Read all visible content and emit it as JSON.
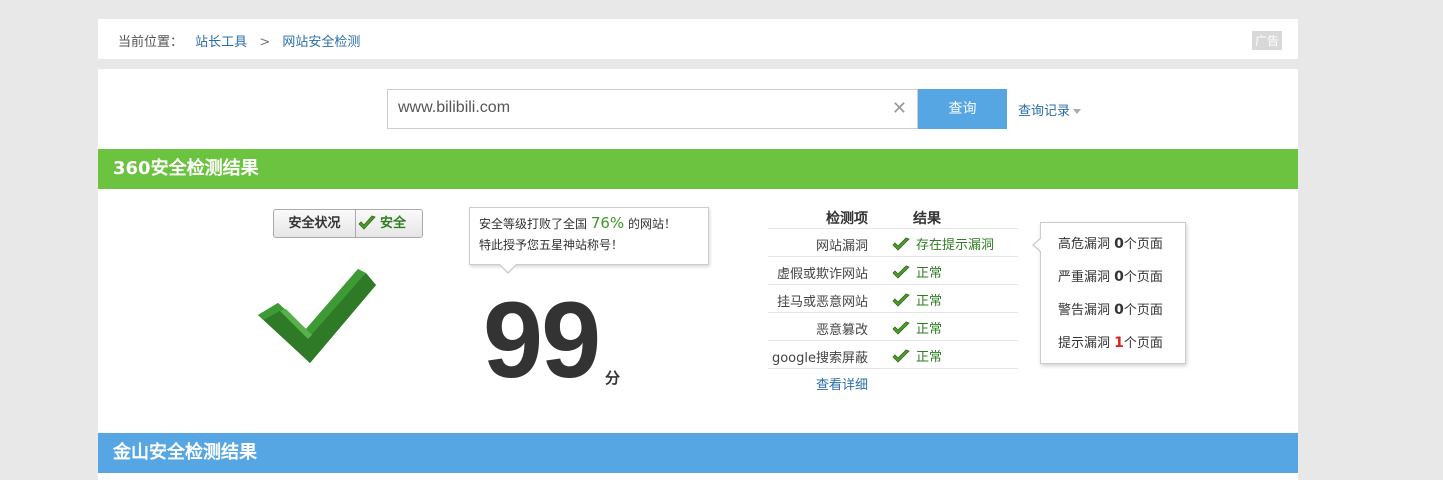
{
  "breadcrumb": {
    "label": "当前位置：",
    "items": [
      "站长工具",
      "网站安全检测"
    ],
    "separator": ">",
    "ad_label": "广告"
  },
  "search": {
    "value": "www.bilibili.com",
    "clear_icon": "close-icon",
    "button_label": "查询",
    "history_label": "查询记录"
  },
  "section_360": {
    "title": "360安全检测结果",
    "status_label": "安全状况",
    "status_value": "安全",
    "tooltip_prefix": "安全等级打败了全国 ",
    "tooltip_percent": "76%",
    "tooltip_suffix": " 的网站！",
    "tooltip_line2": "特此授予您五星神站称号！",
    "score": "99",
    "score_unit": "分",
    "table_header_item": "检测项",
    "table_header_result": "结果",
    "rows": [
      {
        "item": "网站漏洞",
        "result": "存在提示漏洞"
      },
      {
        "item": "虚假或欺诈网站",
        "result": "正常"
      },
      {
        "item": "挂马或恶意网站",
        "result": "正常"
      },
      {
        "item": "恶意篡改",
        "result": "正常"
      },
      {
        "item": "google搜索屏蔽",
        "result": "正常"
      }
    ],
    "detail_link": "查看详细",
    "vulns": [
      {
        "name": "高危漏洞",
        "count": "0",
        "unit": "个页面"
      },
      {
        "name": "严重漏洞",
        "count": "0",
        "unit": "个页面"
      },
      {
        "name": "警告漏洞",
        "count": "0",
        "unit": "个页面"
      },
      {
        "name": "提示漏洞",
        "count": "1",
        "unit": "个页面"
      }
    ]
  },
  "section_kingsoft": {
    "title": "金山安全检测结果"
  },
  "colors": {
    "green_header": "#6cc33f",
    "blue_header": "#55a6e2",
    "link": "#2a6ea8",
    "ok_text": "#2e7d23",
    "alert": "#e02020"
  }
}
